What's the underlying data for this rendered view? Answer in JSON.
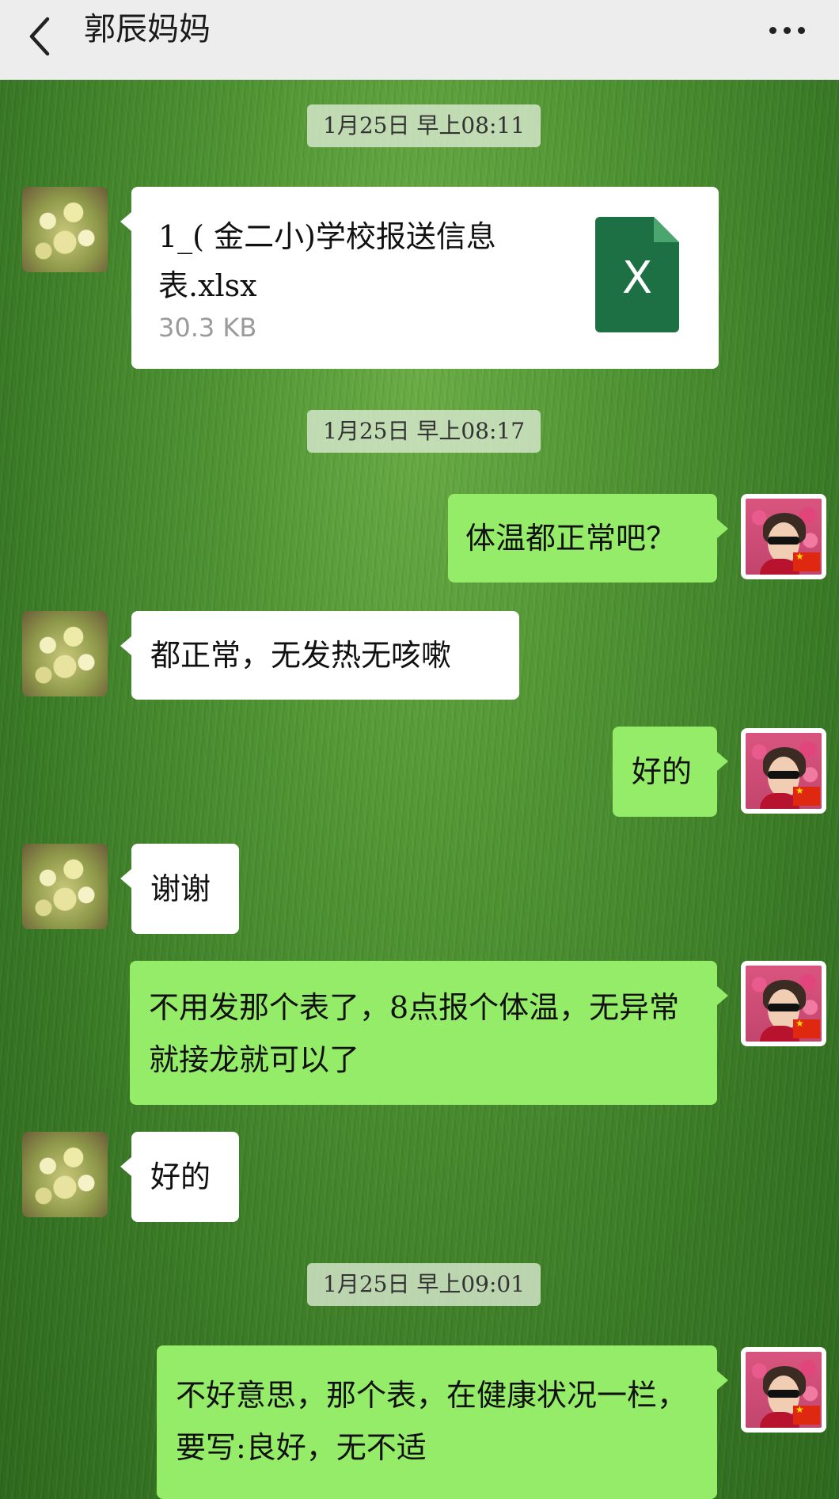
{
  "header": {
    "title": "郭辰妈妈"
  },
  "messages": {
    "t1": "1月25日 早上08:11",
    "file": {
      "name": "1_( 金二小)学校报送信息表.xlsx",
      "size": "30.3 KB",
      "icon_letter": "X"
    },
    "t2": "1月25日 早上08:17",
    "m1": "体温都正常吧？",
    "m2": "都正常，无发热无咳嗽",
    "m3": "好的",
    "m4": "谢谢",
    "m5": "不用发那个表了，8点报个体温，无异常就接龙就可以了",
    "m6": "好的",
    "t3": "1月25日 早上09:01",
    "m7": "不好意思，那个表，在健康状况一栏，要写:良好，无不适"
  },
  "colors": {
    "outgoing_bubble": "#95ec69",
    "incoming_bubble": "#ffffff",
    "header_bg": "#ededed"
  }
}
